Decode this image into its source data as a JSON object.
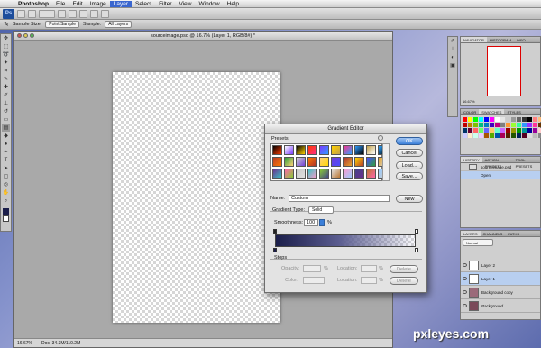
{
  "menubar": {
    "apple": "",
    "items": [
      "Photoshop",
      "File",
      "Edit",
      "Image",
      "Layer",
      "Select",
      "Filter",
      "View",
      "Window",
      "Help"
    ],
    "active_index": 4
  },
  "options": {
    "sample_size_label": "Sample Size:",
    "sample_size_value": "Point Sample",
    "sample_label": "Sample:",
    "sample_value": "All Layers"
  },
  "document": {
    "title": "sourceimage.psd @ 16.7% (Layer 1, RGB/8#) *",
    "zoom": "16.67%",
    "doc_size": "Doc: 34.3M/110.2M"
  },
  "dialog": {
    "title": "Gradient Editor",
    "presets_label": "Presets",
    "buttons": {
      "ok": "OK",
      "cancel": "Cancel",
      "load": "Load...",
      "save": "Save...",
      "new": "New"
    },
    "name_label": "Name:",
    "name_value": "Custom",
    "gradient_type_label": "Gradient Type:",
    "gradient_type_value": "Solid",
    "smoothness_label": "Smoothness:",
    "smoothness_value": "100",
    "smoothness_unit": "%",
    "stops_label": "Stops",
    "opacity_label": "Opacity:",
    "color_label": "Color:",
    "location_label": "Location:",
    "percent": "%",
    "delete_label": "Delete",
    "preset_colors": [
      [
        "#000000",
        "#ffffff",
        "#000000",
        "#ff3b00",
        "#7a3cff",
        "#ffd000",
        "#ff2d8a",
        "#2f9cff",
        "#c3a24b",
        "#2fa4ff"
      ],
      [
        "#b73c2a",
        "#2f9f3a",
        "#d1d1d1",
        "#ff7a00",
        "#ffd27a",
        "#6f3fd6",
        "#aa2f2f",
        "#ffd800",
        "#4b4bff",
        "#e6a62f"
      ],
      [
        "#6a2f8f",
        "#ff66aa",
        "#c9c9c9",
        "#3ac3c3",
        "#88cc33",
        "#e0e0e0",
        "#ff99cc",
        "#444488",
        "#bb7733",
        "#99ccff"
      ]
    ]
  },
  "panels": {
    "navigator_tabs": [
      "NAVIGATOR",
      "HISTOGRAM",
      "INFO"
    ],
    "navigator_zoom": "16.67%",
    "color_tabs": [
      "COLOR",
      "SWATCHES",
      "STYLES"
    ],
    "swatch_colors": [
      "#ff0000",
      "#ffff00",
      "#00ff00",
      "#00ffff",
      "#0000ff",
      "#ff00ff",
      "#ffffff",
      "#e6e6e6",
      "#cccccc",
      "#999999",
      "#666666",
      "#333333",
      "#000000",
      "#ff7f7f",
      "#ffbf7f",
      "#ffff7f",
      "#bf0000",
      "#bf7f00",
      "#7fbf00",
      "#00bf7f",
      "#007fbf",
      "#3f00bf",
      "#bf007f",
      "#7f7f7f",
      "#ff9933",
      "#99ff33",
      "#33ff99",
      "#3399ff",
      "#9933ff",
      "#ff3399",
      "#663300",
      "#336600",
      "#003366",
      "#660033",
      "#ff6666",
      "#66ff66",
      "#6666ff",
      "#ffcc66",
      "#66ffcc",
      "#cc66ff",
      "#990000",
      "#999900",
      "#009900",
      "#009999",
      "#000099",
      "#990099",
      "#ffcccc",
      "#ccffcc",
      "#ccccff",
      "#ffeecc",
      "#ccffee",
      "#eeccff",
      "#aa5500",
      "#55aa00",
      "#0055aa",
      "#aa0055",
      "#552200",
      "#225500",
      "#002255",
      "#550022",
      "#dddddd",
      "#bbbbbb",
      "#888888",
      "#444444"
    ],
    "history_tabs": [
      "HISTORY",
      "ACTION PRESETS",
      "TOOL PRESETS"
    ],
    "history_items": [
      "sourceimage.psd",
      "Open"
    ],
    "layers_tabs": [
      "LAYERS",
      "CHANNELS",
      "PATHS"
    ],
    "layers_mode": "Normal",
    "layers": [
      "Layer 2",
      "Layer 1",
      "Background copy",
      "Background"
    ]
  },
  "watermark": "pxleyes.com"
}
